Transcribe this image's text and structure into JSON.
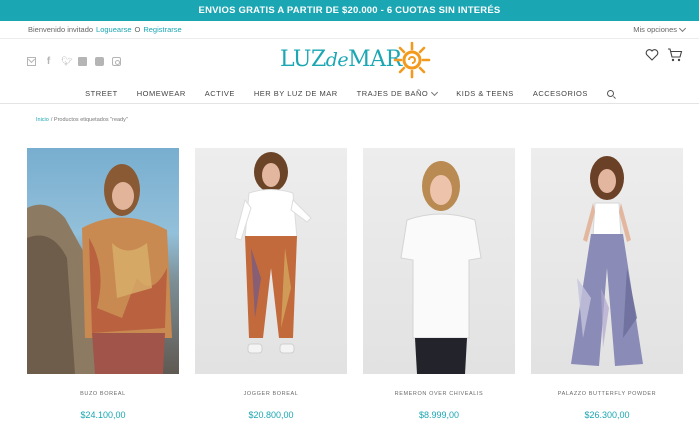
{
  "promo": {
    "text": "ENVIOS GRATIS A PARTIR DE $20.000 - 6 CUOTAS SIN INTERÉS"
  },
  "account": {
    "welcome": "Bienvenido invitado",
    "login": "Loguearse",
    "or": "O",
    "register": "Registrarse",
    "my_options": "Mis opciones"
  },
  "social": [
    "mail-icon",
    "facebook-icon",
    "twitter-icon",
    "vimeo-icon",
    "youtube-icon",
    "instagram-icon"
  ],
  "logo": {
    "text_a": "LUZ",
    "text_b": "de",
    "text_c": "MAR"
  },
  "nav": {
    "items": [
      "STREET",
      "HOMEWEAR",
      "ACTIVE",
      "HER BY LUZ DE MAR",
      "TRAJES DE BAÑO",
      "KIDS & TEENS",
      "ACCESORIOS"
    ]
  },
  "breadcrumb": {
    "home": "Inicio",
    "current": "/ Productos etiquetados \"ready\""
  },
  "products": [
    {
      "name": "BUZO BOREAL",
      "price": "$24.100,00"
    },
    {
      "name": "JOGGER BOREAL",
      "price": "$20.800,00"
    },
    {
      "name": "REMERON OVER CHIVEALIS",
      "price": "$8.999,00"
    },
    {
      "name": "PALAZZO BUTTERFLY POWDER",
      "price": "$26.300,00"
    }
  ],
  "colors": {
    "accent": "#1aa6b3",
    "logo_sun": "#f39a1e"
  }
}
